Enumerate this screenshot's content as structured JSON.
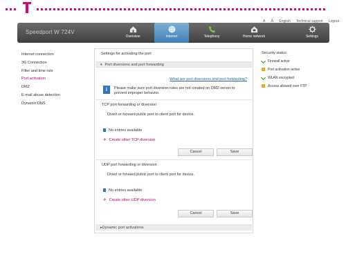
{
  "header": {
    "brand": "Speedport W 724V",
    "utility": {
      "font_small": "A",
      "font_large": "A",
      "language": "English",
      "support": "Technical support",
      "logout": "Logout"
    },
    "nav": [
      {
        "label": "Overview",
        "icon": "home-icon"
      },
      {
        "label": "Internet",
        "icon": "globe-icon",
        "active": true
      },
      {
        "label": "Telephony",
        "icon": "phone-icon"
      },
      {
        "label": "Home network",
        "icon": "house-icon"
      },
      {
        "label": "Settings",
        "icon": "gear-icon"
      }
    ]
  },
  "sidebar": {
    "items": [
      {
        "label": "Internet connection"
      },
      {
        "label": "3G Connection"
      },
      {
        "label": "Filter and time rule"
      },
      {
        "label": "Port activation",
        "active": true
      },
      {
        "label": "DMZ"
      },
      {
        "label": "E-mail abuse detection"
      },
      {
        "label": "Dynamic DNS"
      }
    ]
  },
  "main": {
    "title": "Settings for activating the port",
    "section1": {
      "heading": "Port diversions and port forwarding",
      "help_link": "What are port diversions and port forwarding?",
      "info": "Please make sure port diversion rules are not created on DMZ server to prevent improper behavior."
    },
    "tcp": {
      "title": "TCP port forwarding or diversion",
      "desc": "Divert or forward public port to client port for device.",
      "empty": "No entries available",
      "create": "Create other TCP diversion",
      "cancel": "Cancel",
      "save": "Save"
    },
    "udp": {
      "title": "UDP port forwarding or diversion",
      "desc": "Divert or forward public port to client port for device.",
      "empty": "No entries available",
      "create": "Create other UDP diversion",
      "cancel": "Cancel",
      "save": "Save"
    },
    "section2": {
      "heading": "Dynamic port activations"
    }
  },
  "security": {
    "heading": "Security status",
    "items": [
      {
        "label": "Firewall active",
        "status": "ok"
      },
      {
        "label": "Port activation active",
        "status": "warn"
      },
      {
        "label": "WLAN encrypted",
        "status": "ok"
      },
      {
        "label": "Access allowed over FTP",
        "status": "warn"
      }
    ]
  },
  "colors": {
    "brand_magenta": "#e20074",
    "nav_active": "#3d7fb8",
    "link_blue": "#2a6aa8",
    "info_blue": "#2b78be"
  }
}
